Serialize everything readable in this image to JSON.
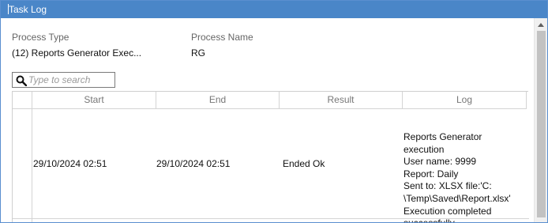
{
  "window": {
    "title": "Task Log"
  },
  "header": {
    "process_type_label": "Process Type",
    "process_type_value": "(12) Reports Generator Exec...",
    "process_name_label": "Process Name",
    "process_name_value": "RG"
  },
  "search": {
    "placeholder": "Type to search",
    "icon": "search-icon"
  },
  "table": {
    "columns": [
      "Start",
      "End",
      "Result",
      "Log"
    ],
    "rows": [
      {
        "start": "29/10/2024 02:51",
        "end": "29/10/2024 02:51",
        "result": "Ended Ok",
        "log_lines": [
          "Reports Generator execution",
          "User name: 9999",
          "Report: Daily",
          "Sent to: XLSX file:'C:",
          "\\Temp\\Saved\\Report.xlsx'",
          "Execution completed",
          "successfully"
        ]
      }
    ]
  },
  "colors": {
    "titlebar": "#4a86c8",
    "border": "#5a8fd0"
  }
}
